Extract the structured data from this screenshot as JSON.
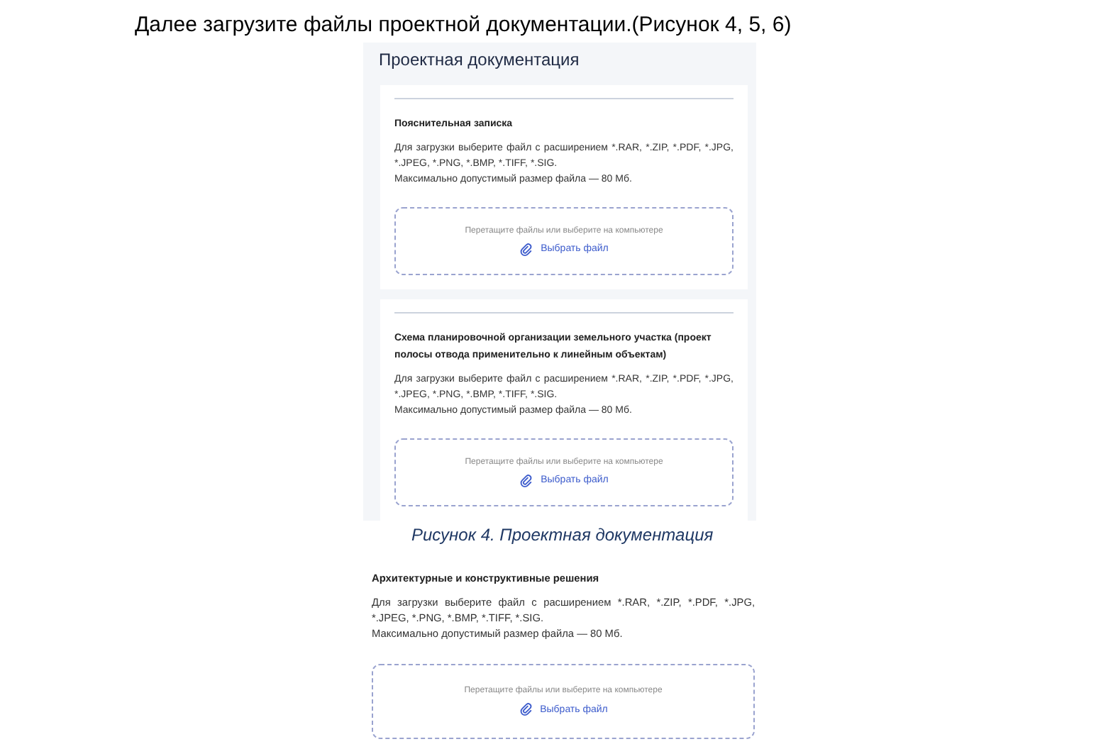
{
  "heading": "Далее загрузите файлы проектной документации.(Рисунок 4, 5, 6)",
  "figures": [
    {
      "title": "Проектная документация",
      "kind": "panel",
      "caption": "Рисунок 4. Проектная документация",
      "sections": [
        {
          "label": "Пояснительная записка",
          "divider": true,
          "formats": "Для загрузки выберите файл с расширением *.RAR, *.ZIP, *.PDF, *.JPG, *.JPEG, *.PNG, *.BMP, *.TIFF, *.SIG.",
          "max_size": "Максимально допустимый размер файла — 80 Мб.",
          "dropzone": {
            "hint": "Перетащите файлы или выберите на компьютере",
            "button": "Выбрать файл"
          }
        },
        {
          "label": "Схема планировочной организации земельного участка (проект полосы отвода применительно к линейным объектам)",
          "divider": true,
          "formats": "Для загрузки выберите файл с расширением *.RAR, *.ZIP, *.PDF, *.JPG, *.JPEG, *.PNG, *.BMP, *.TIFF, *.SIG.",
          "max_size": "Максимально допустимый размер файла — 80 Мб.",
          "dropzone": {
            "hint": "Перетащите файлы или выберите на компьютере",
            "button": "Выбрать файл"
          }
        }
      ]
    },
    {
      "kind": "card",
      "sections": [
        {
          "label": "Архитектурные и конструктивные решения",
          "divider": false,
          "formats": "Для загрузки выберите файл с расширением *.RAR, *.ZIP, *.PDF, *.JPG, *.JPEG, *.PNG, *.BMP, *.TIFF, *.SIG.",
          "max_size": "Максимально допустимый размер файла — 80 Мб.",
          "dropzone": {
            "hint": "Перетащите файлы или выберите на компьютере",
            "button": "Выбрать файл"
          }
        }
      ]
    }
  ]
}
